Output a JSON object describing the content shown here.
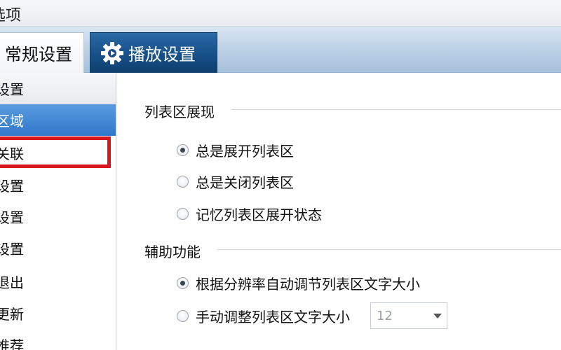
{
  "window": {
    "title": "选项"
  },
  "tabs": [
    {
      "label": "常规设置"
    },
    {
      "label": "播放设置"
    }
  ],
  "sidebar": {
    "items": [
      {
        "label": "设置"
      },
      {
        "label": "区域"
      },
      {
        "label": "关联"
      },
      {
        "label": "设置"
      },
      {
        "label": "设置"
      },
      {
        "label": "设置"
      },
      {
        "label": "退出"
      },
      {
        "label": "更新"
      },
      {
        "label": "推荐"
      }
    ]
  },
  "sections": {
    "list_display": {
      "title": "列表区展现",
      "options": [
        {
          "label": "总是展开列表区",
          "checked": true
        },
        {
          "label": "总是关闭列表区",
          "checked": false
        },
        {
          "label": "记忆列表区展开状态",
          "checked": false
        }
      ]
    },
    "assist": {
      "title": "辅助功能",
      "options": [
        {
          "label": "根据分辨率自动调节列表区文字大小",
          "checked": true
        },
        {
          "label": "手动调整列表区文字大小",
          "checked": false
        }
      ],
      "font_size": {
        "value": "12"
      }
    }
  },
  "colors": {
    "accent": "#2f78c9",
    "tab_active": "#175088",
    "highlight": "#d8141c"
  },
  "icons": {
    "playback_tab": "gear-icon",
    "dropdown": "chevron-down-icon"
  }
}
